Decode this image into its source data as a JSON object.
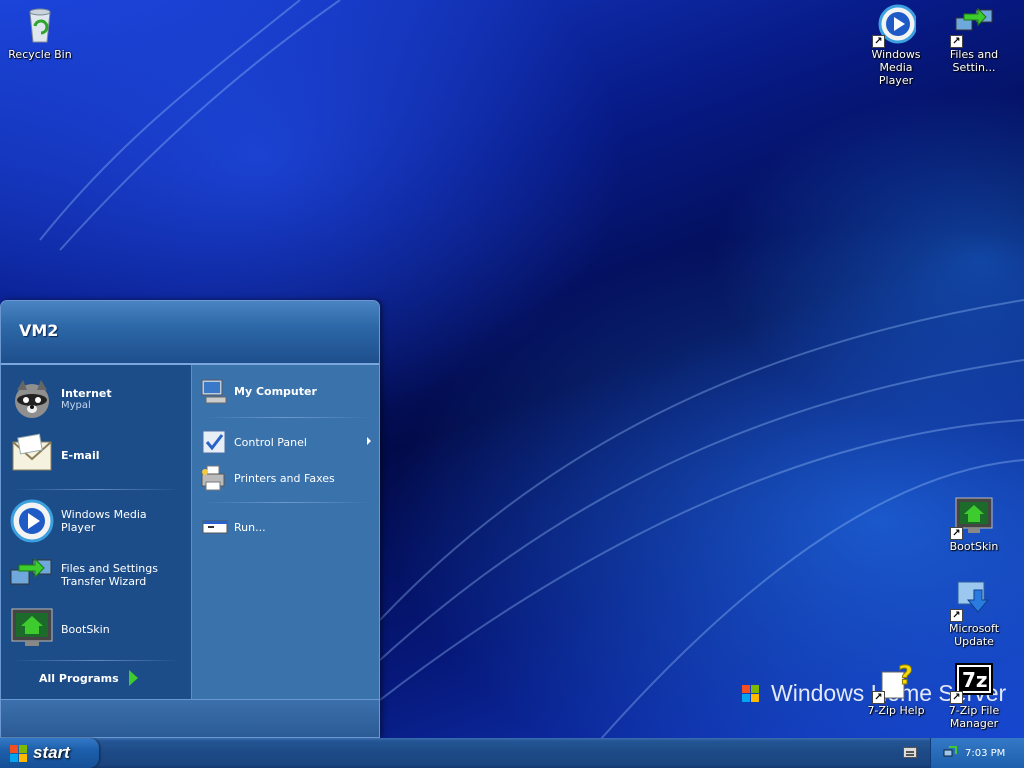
{
  "desktop": {
    "icons": {
      "recycle_bin": "Recycle Bin",
      "wmp": "Windows Media\nPlayer",
      "files_settings": "Files and\nSettin...",
      "bootskin": "BootSkin",
      "microsoft_update": "Microsoft\nUpdate",
      "zip_help": "7-Zip Help",
      "zip_manager": "7-Zip File\nManager"
    },
    "branding": "Windows Home Server"
  },
  "start_menu": {
    "user": "VM2",
    "left_pinned": [
      {
        "title": "Internet",
        "subtitle": "Mypal"
      },
      {
        "title": "E-mail"
      }
    ],
    "left_recent": [
      {
        "label": "Windows Media Player"
      },
      {
        "label": "Files and Settings\nTransfer Wizard"
      },
      {
        "label": "BootSkin"
      }
    ],
    "all_programs": "All Programs",
    "right_items": [
      {
        "label": "My Computer"
      },
      {
        "label": "Control Panel"
      },
      {
        "label": "Printers and Faxes"
      },
      {
        "label": "Run..."
      }
    ]
  },
  "taskbar": {
    "start": "start",
    "clock": "7:03 PM"
  },
  "colors": {
    "taskbar": "#1d4a86",
    "start_button": "#1d5fab",
    "menu_left": "#1d4d88",
    "menu_right": "#3a72ac"
  }
}
